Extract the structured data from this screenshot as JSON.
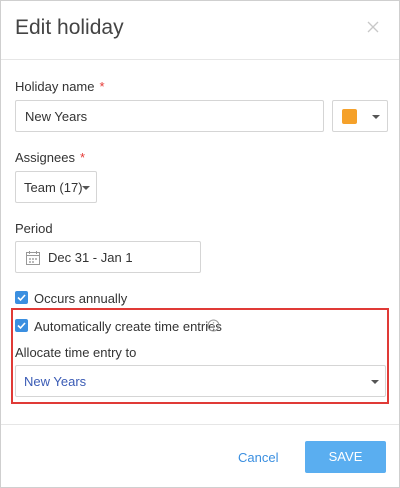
{
  "dialog": {
    "title": "Edit holiday"
  },
  "holiday_name": {
    "label": "Holiday name",
    "required_mark": "*",
    "value": "New Years",
    "color": "#f5a12a"
  },
  "assignees": {
    "label": "Assignees",
    "required_mark": "*",
    "value": "Team (17)"
  },
  "period": {
    "label": "Period",
    "value": "Dec 31 - Jan 1"
  },
  "occurs_annually": {
    "label": "Occurs annually",
    "checked": true
  },
  "auto_time_entries": {
    "label": "Automatically create time entries",
    "checked": true
  },
  "allocate": {
    "label": "Allocate time entry to",
    "value": "New Years"
  },
  "footer": {
    "cancel_label": "Cancel",
    "save_label": "SAVE"
  },
  "colors": {
    "accent": "#3b8fe0",
    "save_button": "#5aaef0",
    "highlight_border": "#e03a36"
  }
}
